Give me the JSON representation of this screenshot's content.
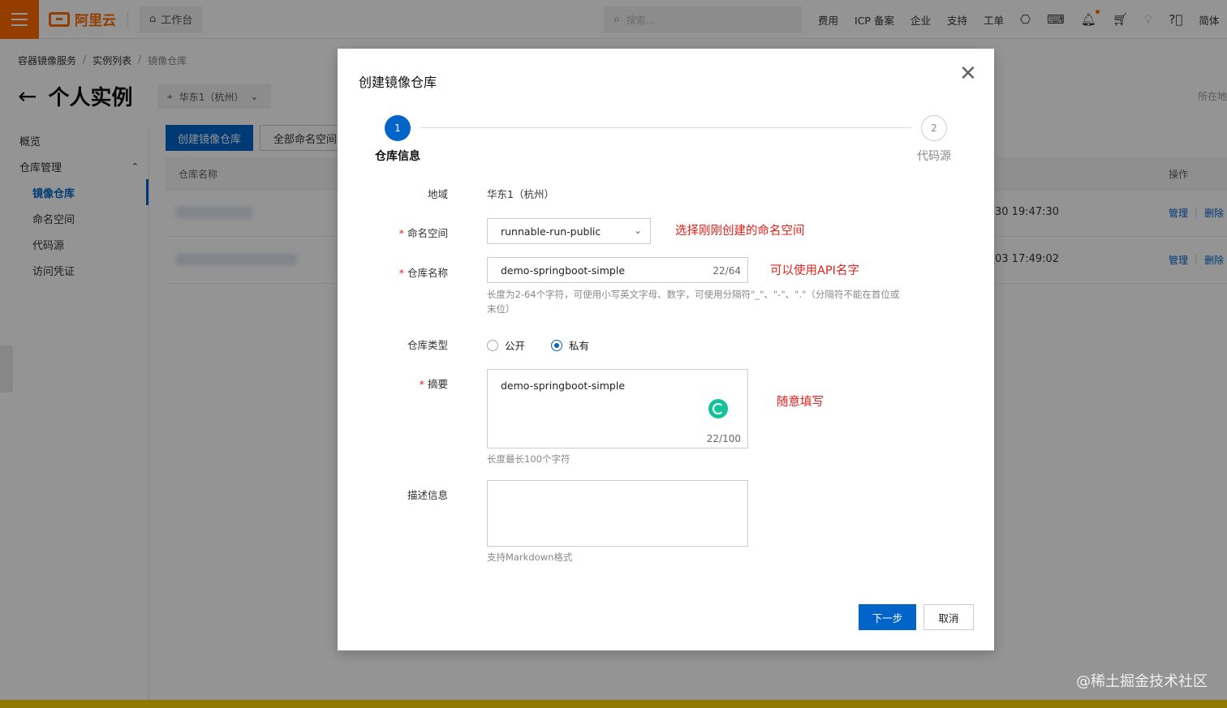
{
  "topbar": {
    "logo_text": "阿里云",
    "workbench_label": "工作台",
    "search_placeholder": "搜索...",
    "links": [
      "费用",
      "ICP 备案",
      "企业",
      "支持",
      "工单"
    ],
    "lang": "简体",
    "accent_color": "#ff6a00"
  },
  "breadcrumb": [
    "容器镜像服务",
    "实例列表",
    "镜像仓库"
  ],
  "page": {
    "title": "个人实例",
    "region": "华东1（杭州）",
    "location_right": "所在地"
  },
  "left_nav": {
    "overview": "概览",
    "repo_mgmt": "仓库管理",
    "items": [
      "镜像仓库",
      "命名空间",
      "代码源",
      "访问凭证"
    ]
  },
  "background": {
    "create_button": "创建镜像仓库",
    "namespace_filter": "全部命名空间",
    "col_name": "仓库名称",
    "col_ops": "操作",
    "rows": [
      {
        "time": "30 19:47:30",
        "manage": "管理",
        "delete": "删除"
      },
      {
        "time": "03 17:49:02",
        "manage": "管理",
        "delete": "删除"
      }
    ]
  },
  "modal": {
    "title": "创建镜像仓库",
    "steps": [
      {
        "num": "1",
        "label": "仓库信息"
      },
      {
        "num": "2",
        "label": "代码源"
      }
    ],
    "region_label": "地域",
    "region_value": "华东1（杭州）",
    "namespace_label": "命名空间",
    "namespace_value": "runnable-run-public",
    "namespace_note": "选择刚刚创建的命名空间",
    "repo_name_label": "仓库名称",
    "repo_name_value": "demo-springboot-simple",
    "repo_name_count": "22/64",
    "repo_name_note": "可以使用API名字",
    "repo_name_hint_1": "长度为2-64个字符，可使用小写英文字母、数字，可使用分隔符\"_\"、\"-\"、\".\"（分隔符不能在首位或",
    "repo_name_hint_2": "末位）",
    "repo_type_label": "仓库类型",
    "repo_type_public": "公开",
    "repo_type_private": "私有",
    "repo_type_selected": "私有",
    "summary_label": "摘要",
    "summary_value": "demo-springboot-simple",
    "summary_count": "22/100",
    "summary_note": "随意填写",
    "summary_hint": "长度最长100个字符",
    "desc_label": "描述信息",
    "desc_value": "",
    "desc_hint": "支持Markdown格式",
    "next_button": "下一步",
    "cancel_button": "取消",
    "primary_color": "#0064c8",
    "note_color": "#e0201a"
  },
  "watermark": "@稀土掘金技术社区"
}
